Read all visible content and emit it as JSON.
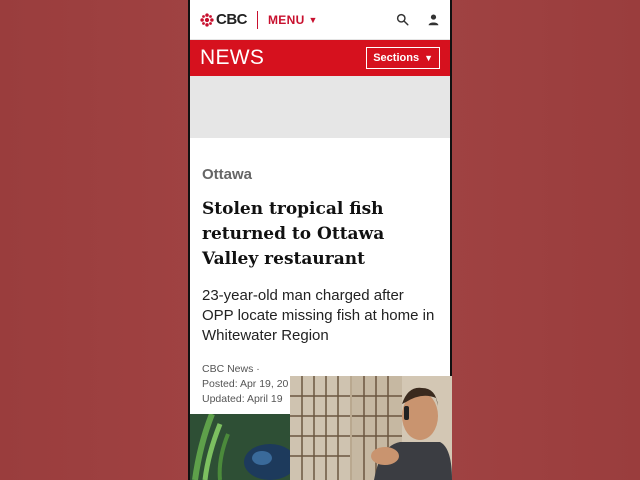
{
  "header": {
    "logo_text": "CBC",
    "menu_label": "MENU",
    "search_icon": "search-icon",
    "account_icon": "user-icon"
  },
  "section_bar": {
    "title": "NEWS",
    "sections_label": "Sections"
  },
  "article": {
    "category": "Ottawa",
    "headline": "Stolen tropical fish returned to Ottawa Valley restaurant",
    "deck": "23-year-old man charged after OPP locate missing fish at home in Whitewater Region",
    "source": "CBC News ·",
    "posted": "Posted: Apr 19, 20",
    "updated": "Updated: April 19"
  },
  "colors": {
    "brand_red": "#d6111e",
    "background": "#9b3f3f"
  }
}
